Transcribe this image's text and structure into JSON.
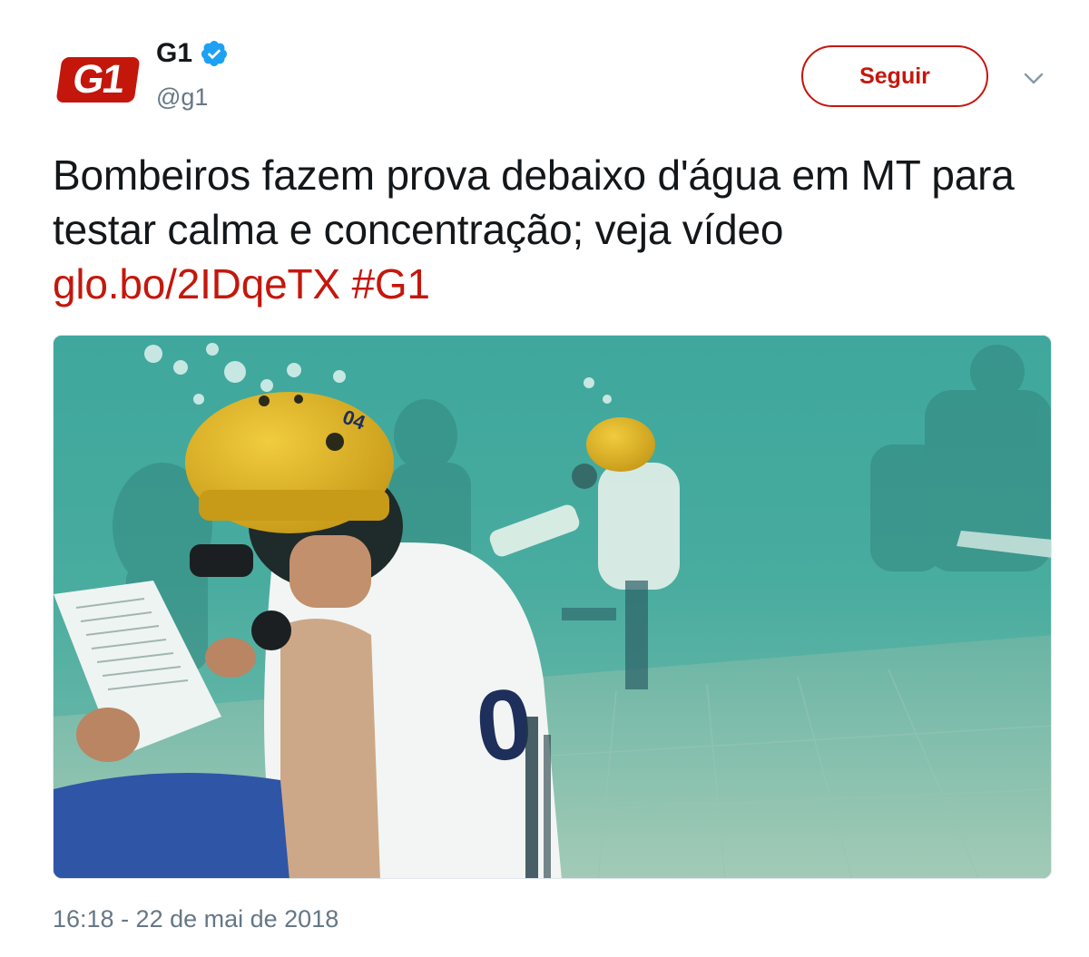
{
  "tweet": {
    "author": {
      "display_name": "G1",
      "handle": "@g1",
      "avatar_text": "G1",
      "verified": true
    },
    "follow_label": "Seguir",
    "text": "Bombeiros fazem prova debaixo d'água em MT para testar calma e concentração; veja vídeo ",
    "link": "glo.bo/2IDqeTX",
    "hashtag": "#G1",
    "media": {
      "helmet_number": "04"
    },
    "timestamp": "16:18 - 22 de mai de 2018"
  },
  "colors": {
    "accent": "#c4170c",
    "text": "#14171a",
    "secondary_text": "#657786",
    "verified": "#1da1f2"
  },
  "icons": {
    "verified": "verified-badge-icon",
    "caret": "chevron-down-icon"
  }
}
